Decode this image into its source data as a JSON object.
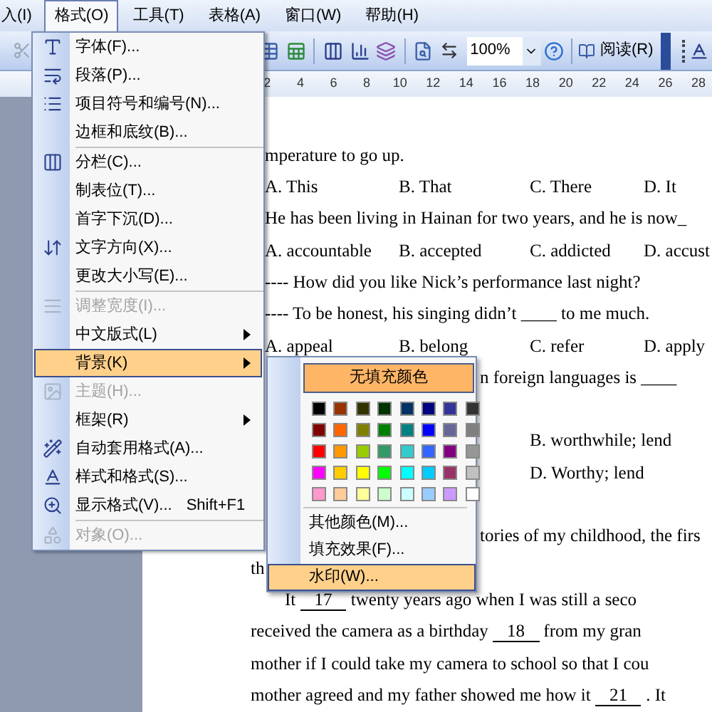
{
  "menu_bar": [
    {
      "label": "入(I)",
      "selected": false
    },
    {
      "label": "格式(O)",
      "selected": true
    },
    {
      "label": "工具(T)",
      "selected": false
    },
    {
      "label": "表格(A)",
      "selected": false
    },
    {
      "label": "窗口(W)",
      "selected": false
    },
    {
      "label": "帮助(H)",
      "selected": false
    }
  ],
  "toolbar": {
    "zoom": "100%",
    "read_button": "阅读(R)"
  },
  "ruler": [
    "2",
    "4",
    "6",
    "8",
    "10",
    "12",
    "14",
    "16",
    "18",
    "20",
    "22",
    "24",
    "26",
    "28"
  ],
  "document": {
    "lines": [
      {
        "kind": "text",
        "parts": [
          {
            "text": "mperature to go up.",
            "blank": false
          }
        ]
      },
      {
        "kind": "options",
        "options": [
          "A. This",
          "B. That",
          "C. There",
          "D. It"
        ]
      },
      {
        "kind": "text",
        "parts": [
          {
            "text": "He has been living in Hainan for two years, and he is now_",
            "blank": false
          }
        ]
      },
      {
        "kind": "options",
        "options": [
          "A. accountable",
          "B. accepted",
          "C. addicted",
          "D. accust"
        ]
      },
      {
        "kind": "text",
        "parts": [
          {
            "text": "---- How did you like Nick’s performance last night?",
            "blank": false
          }
        ]
      },
      {
        "kind": "text",
        "parts": [
          {
            "text": "---- To be honest, his singing didn’t  ____  to me much.",
            "blank": false
          }
        ]
      },
      {
        "kind": "options",
        "options": [
          "A. appeal",
          "B. belong",
          "C. refer",
          "D. apply"
        ]
      },
      {
        "kind": "covered",
        "parts": [
          {
            "text": "n  foreign  languages  is  ____",
            "blank": false
          }
        ]
      },
      {
        "kind": "gap"
      },
      {
        "kind": "offset",
        "parts": [
          {
            "text": "B. worthwhile; lend",
            "blank": false
          }
        ]
      },
      {
        "kind": "offset",
        "parts": [
          {
            "text": "D. Worthy; lend",
            "blank": false
          }
        ]
      },
      {
        "kind": "gap"
      },
      {
        "kind": "covered",
        "parts": [
          {
            "text": "tories of my childhood, the firs",
            "blank": false
          }
        ]
      },
      {
        "kind": "body",
        "parts": [
          {
            "text": "th",
            "blank": false
          }
        ]
      },
      {
        "kind": "indent",
        "parts": [
          {
            "text": "It",
            "blank": false
          },
          {
            "text": "17",
            "blank": true
          },
          {
            "text": "twenty years ago when I was still a seco",
            "blank": false
          }
        ]
      },
      {
        "kind": "body",
        "parts": [
          {
            "text": "received the camera as a birthday",
            "blank": false
          },
          {
            "text": "18",
            "blank": true
          },
          {
            "text": "from my gran",
            "blank": false
          }
        ]
      },
      {
        "kind": "body",
        "parts": [
          {
            "text": "mother if I could take my camera to school so that I cou",
            "blank": false
          }
        ]
      },
      {
        "kind": "body",
        "parts": [
          {
            "text": "mother agreed and my father showed me how it",
            "blank": false
          },
          {
            "text": "21",
            "blank": true
          },
          {
            "text": ". It",
            "blank": false
          }
        ]
      }
    ]
  },
  "format_menu": {
    "items": [
      {
        "kind": "item",
        "label": "字体(F)...",
        "disabled": false,
        "submenu": false,
        "selected": false
      },
      {
        "kind": "item",
        "label": "段落(P)...",
        "disabled": false,
        "submenu": false,
        "selected": false
      },
      {
        "kind": "item",
        "label": "项目符号和编号(N)...",
        "disabled": false,
        "submenu": false,
        "selected": false
      },
      {
        "kind": "item",
        "label": "边框和底纹(B)...",
        "disabled": false,
        "submenu": false,
        "selected": false
      },
      {
        "kind": "separator"
      },
      {
        "kind": "item",
        "label": "分栏(C)...",
        "disabled": false,
        "submenu": false,
        "selected": false
      },
      {
        "kind": "item",
        "label": "制表位(T)...",
        "disabled": false,
        "submenu": false,
        "selected": false
      },
      {
        "kind": "item",
        "label": "首字下沉(D)...",
        "disabled": false,
        "submenu": false,
        "selected": false
      },
      {
        "kind": "item",
        "label": "文字方向(X)...",
        "disabled": false,
        "submenu": false,
        "selected": false
      },
      {
        "kind": "item",
        "label": "更改大小写(E)...",
        "disabled": false,
        "submenu": false,
        "selected": false
      },
      {
        "kind": "separator"
      },
      {
        "kind": "item",
        "label": "调整宽度(I)...",
        "disabled": true,
        "submenu": false,
        "selected": false
      },
      {
        "kind": "item",
        "label": "中文版式(L)",
        "disabled": false,
        "submenu": true,
        "selected": false
      },
      {
        "kind": "item",
        "label": "背景(K)",
        "disabled": false,
        "submenu": true,
        "selected": true
      },
      {
        "kind": "item",
        "label": "主题(H)...",
        "disabled": true,
        "submenu": false,
        "selected": false
      },
      {
        "kind": "item",
        "label": "框架(R)",
        "disabled": false,
        "submenu": true,
        "selected": false
      },
      {
        "kind": "item",
        "label": "自动套用格式(A)...",
        "disabled": false,
        "submenu": false,
        "selected": false
      },
      {
        "kind": "item",
        "label": "样式和格式(S)...",
        "disabled": false,
        "submenu": false,
        "selected": false
      },
      {
        "kind": "item",
        "label": "显示格式(V)...",
        "shortcut": "Shift+F1",
        "disabled": false,
        "submenu": false,
        "selected": false
      },
      {
        "kind": "separator"
      },
      {
        "kind": "item",
        "label": "对象(O)...",
        "disabled": true,
        "submenu": false,
        "selected": false
      }
    ]
  },
  "background_submenu": {
    "no_fill": "无填充颜色",
    "colors": [
      {
        "color": "#000000"
      },
      {
        "color": "#993300"
      },
      {
        "color": "#333300"
      },
      {
        "color": "#003300"
      },
      {
        "color": "#003366"
      },
      {
        "color": "#000080"
      },
      {
        "color": "#333399"
      },
      {
        "color": "#333333"
      },
      {
        "color": "#800000"
      },
      {
        "color": "#ff6600"
      },
      {
        "color": "#808000"
      },
      {
        "color": "#008000"
      },
      {
        "color": "#008080"
      },
      {
        "color": "#0000ff"
      },
      {
        "color": "#666699"
      },
      {
        "color": "#808080"
      },
      {
        "color": "#ff0000"
      },
      {
        "color": "#ff9900"
      },
      {
        "color": "#99cc00"
      },
      {
        "color": "#339966"
      },
      {
        "color": "#33cccc"
      },
      {
        "color": "#3366ff"
      },
      {
        "color": "#800080"
      },
      {
        "color": "#969696"
      },
      {
        "color": "#ff00ff"
      },
      {
        "color": "#ffcc00"
      },
      {
        "color": "#ffff00"
      },
      {
        "color": "#00ff00"
      },
      {
        "color": "#00ffff"
      },
      {
        "color": "#00ccff"
      },
      {
        "color": "#993366"
      },
      {
        "color": "#c0c0c0"
      },
      {
        "color": "#ff99cc"
      },
      {
        "color": "#ffcc99"
      },
      {
        "color": "#ffff99"
      },
      {
        "color": "#ccffcc"
      },
      {
        "color": "#ccffff"
      },
      {
        "color": "#99ccff"
      },
      {
        "color": "#cc99ff"
      },
      {
        "color": "#ffffff"
      }
    ],
    "items": [
      {
        "label": "其他颜色(M)...",
        "selected": false
      },
      {
        "label": "填充效果(F)...",
        "selected": false
      },
      {
        "label": "水印(W)...",
        "selected": true
      }
    ]
  }
}
